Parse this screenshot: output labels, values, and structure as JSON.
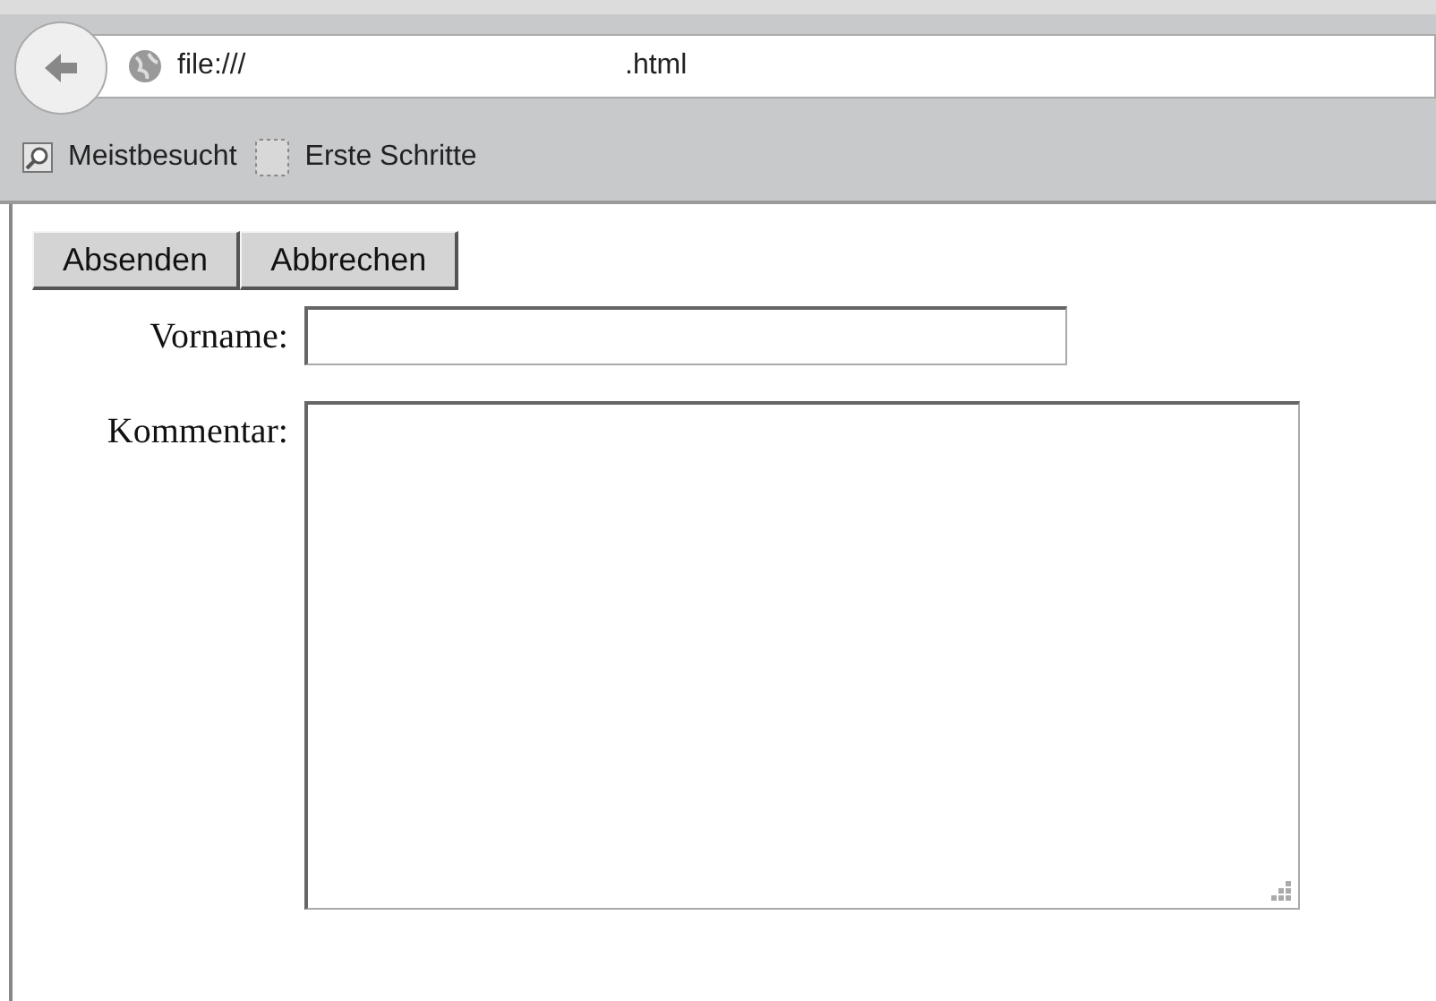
{
  "browser": {
    "address": {
      "start": "file:///",
      "end": ".html"
    },
    "bookmarks": [
      {
        "label": "Meistbesucht",
        "kind": "search"
      },
      {
        "label": "Erste Schritte",
        "kind": "blank"
      }
    ]
  },
  "form": {
    "buttons": [
      "Absenden",
      "Abbrechen"
    ],
    "fields": [
      {
        "label": "Vorname:",
        "kind": "text"
      },
      {
        "label": "Kommentar:",
        "kind": "textarea"
      }
    ]
  }
}
